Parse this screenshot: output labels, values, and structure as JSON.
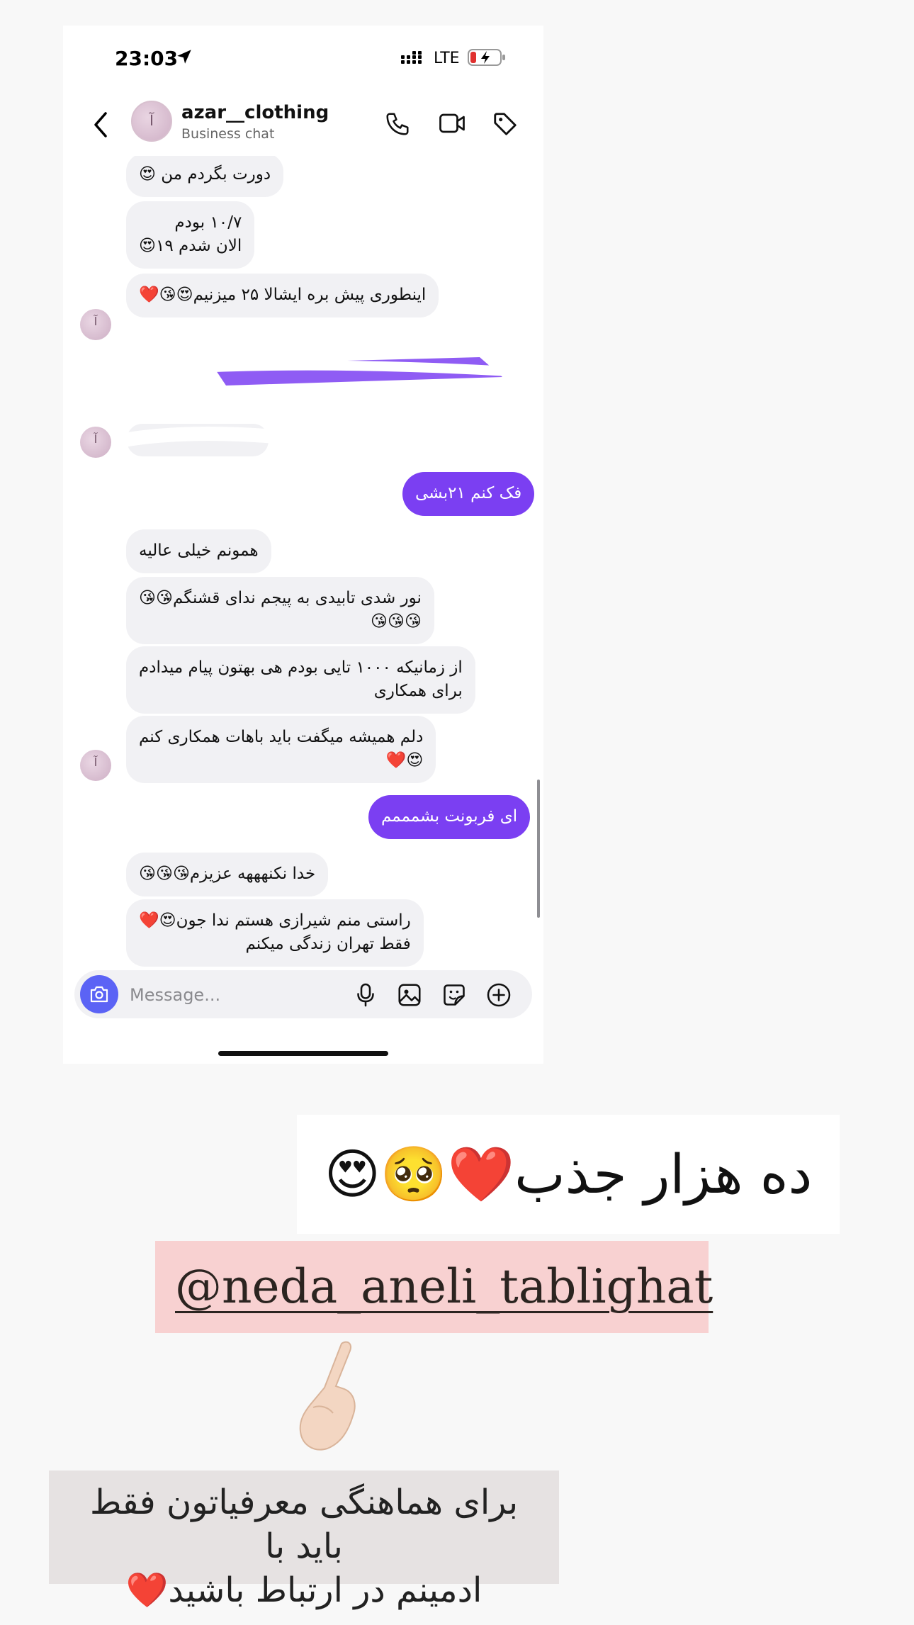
{
  "status_bar": {
    "time": "23:03",
    "network": "LTE"
  },
  "header": {
    "name": "azar__clothing",
    "subtitle": "Business chat"
  },
  "messages": [
    {
      "side": "in",
      "text": "دورت بگردم من 😍"
    },
    {
      "side": "in",
      "text": "۱۰/۷ بودم\nالان شدم ۱۹😍"
    },
    {
      "side": "in",
      "text": "اینطوری پیش بره ایشالا ۲۵ میزنیم😍😘❤️"
    },
    {
      "side": "out",
      "text": "فک کنم ۲۱بشی"
    },
    {
      "side": "in",
      "text": "همونم خیلی عالیه"
    },
    {
      "side": "in",
      "text": "نور شدی تابیدی به پیجم ندای قشنگم😘😘\n😘😘😘"
    },
    {
      "side": "in",
      "text": "از زمانیکه ۱۰۰۰ تایی بودم هی بهتون پیام میدادم\nبرای همکاری"
    },
    {
      "side": "in",
      "text": "دلم همیشه میگفت باید باهات همکاری کنم\n😍❤️"
    },
    {
      "side": "out",
      "text": "ای فربونت بشمممم"
    },
    {
      "side": "in",
      "text": "خدا نکنهههه عزیزم😘😘😘"
    },
    {
      "side": "in",
      "text": "راستی منم شیرازی هستم ندا جون😍❤️\nفقط تهران زندگی میکنم"
    }
  ],
  "composer": {
    "placeholder": "Message..."
  },
  "captions": {
    "headline": "ده هزار جذب❤️🥺😍",
    "handle": "@neda_aneli_tablighat",
    "footer": "برای هماهنگی معرفیاتون فقط باید با\nادمینم در ارتباط باشید❤️"
  },
  "colors": {
    "outgoing_bubble": "#7b3ff2",
    "incoming_bubble": "#f1f1f4",
    "camera_button": "#5b63f5",
    "handle_bg": "#f8d1d1"
  },
  "icons": [
    "location-arrow-icon",
    "signal-icon",
    "battery-icon",
    "back-chevron-icon",
    "phone-icon",
    "video-icon",
    "tag-icon",
    "camera-icon",
    "microphone-icon",
    "gallery-icon",
    "sticker-icon",
    "plus-icon",
    "pointing-hand-icon"
  ]
}
